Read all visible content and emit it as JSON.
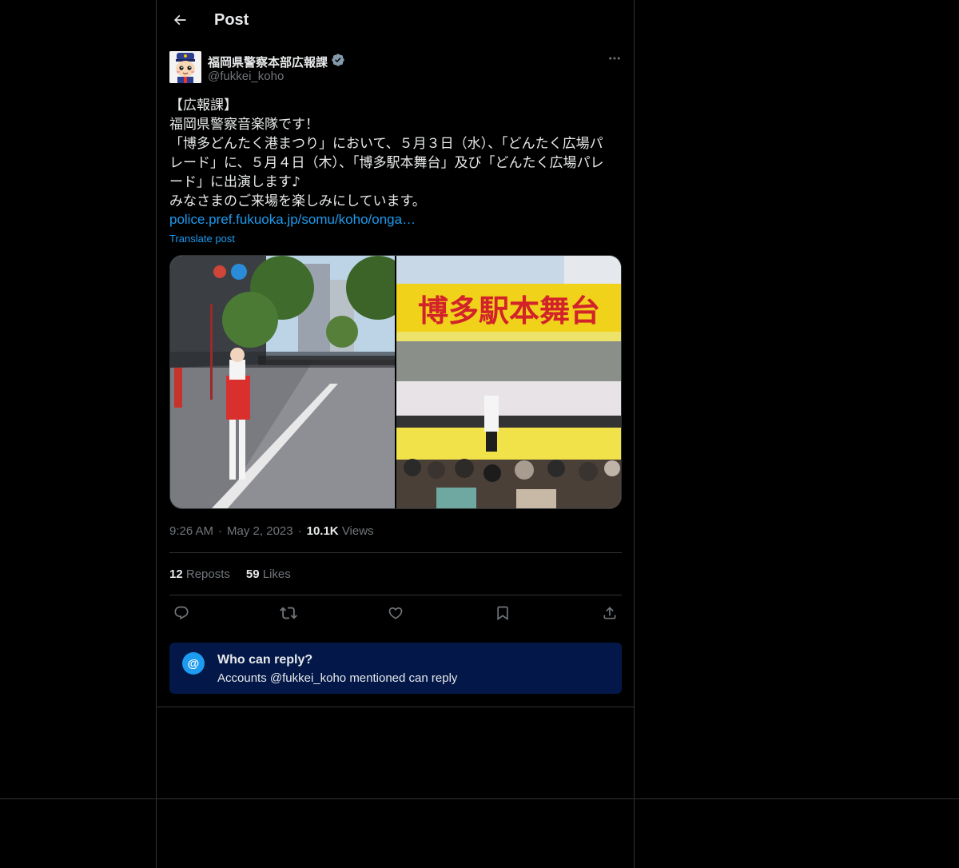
{
  "header": {
    "title": "Post"
  },
  "author": {
    "name": "福岡県警察本部広報課",
    "handle": "@fukkei_koho",
    "verified_color": "#829aab"
  },
  "tweet": {
    "lines": [
      "【広報課】",
      "福岡県警察音楽隊です！",
      "「博多どんたく港まつり」において、５月３日（水）、「どんたく広場パ",
      "レード」に、５月４日（木）、「博多駅本舞台」及び「どんたく広場パレ",
      "ード」に出演します♪",
      "みなさまのご来場を楽しみにしています。"
    ],
    "link": "police.pref.fukuoka.jp/somu/koho/onga…",
    "translate_label": "Translate post"
  },
  "media": {
    "image_right_sign": "博多駅本舞台"
  },
  "meta": {
    "time": "9:26 AM",
    "date": "May 2, 2023",
    "views_count": "10.1K",
    "views_label": "Views"
  },
  "stats": {
    "reposts_count": "12",
    "reposts_label": "Reposts",
    "likes_count": "59",
    "likes_label": "Likes"
  },
  "actions": {
    "icons": [
      "reply-icon",
      "repost-icon",
      "like-icon",
      "bookmark-icon",
      "share-icon"
    ]
  },
  "who_can_reply": {
    "icon_glyph": "@",
    "title": "Who can reply?",
    "subtitle": "Accounts @fukkei_koho mentioned can reply"
  },
  "colors": {
    "background": "#000000",
    "border": "#2f3336",
    "text": "#e7e9ea",
    "muted": "#71767b",
    "accent": "#1d9bf0",
    "reply_box": "#031849"
  }
}
